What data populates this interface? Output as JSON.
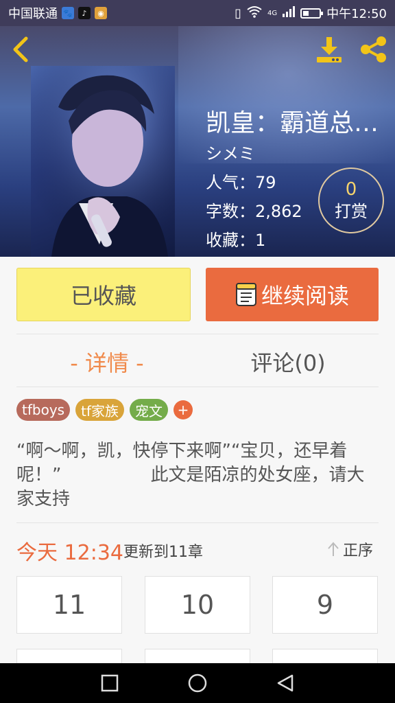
{
  "status_bar": {
    "carrier": "中国联通",
    "network": "4G",
    "time": "中午12:50"
  },
  "book": {
    "title": "凯皇：霸道总…",
    "author": "シメミ",
    "popularity_label": "人气：79",
    "word_count_label": "字数：2,862",
    "favorites_label": "收藏：1",
    "tip_count": "0",
    "tip_label": "打赏"
  },
  "actions": {
    "collected_label": "已收藏",
    "read_label": "继续阅读"
  },
  "tabs": {
    "detail": "- 详情 -",
    "comments": "评论(0)"
  },
  "tags": [
    "tfboys",
    "tf家族",
    "宠文"
  ],
  "tag_add": "+",
  "synopsis": "“啊～啊，凯，快停下来啊”“宝贝，还早着呢！”　　　　　此文是陌凉的处女座，请大家支持",
  "update": {
    "time": "今天 12:34",
    "text": "更新到11章",
    "sort_label": "正序"
  },
  "chapters": [
    "11",
    "10",
    "9"
  ],
  "icons": {
    "back": "chevron-left-icon",
    "download": "download-icon",
    "share": "share-icon",
    "book": "book-icon",
    "sort": "arrow-up-icon"
  },
  "colors": {
    "accent": "#ea6b3f",
    "collected_bg": "#fbf07a",
    "detail_tab": "#f08a4b",
    "icon_yellow": "#f2c418"
  }
}
